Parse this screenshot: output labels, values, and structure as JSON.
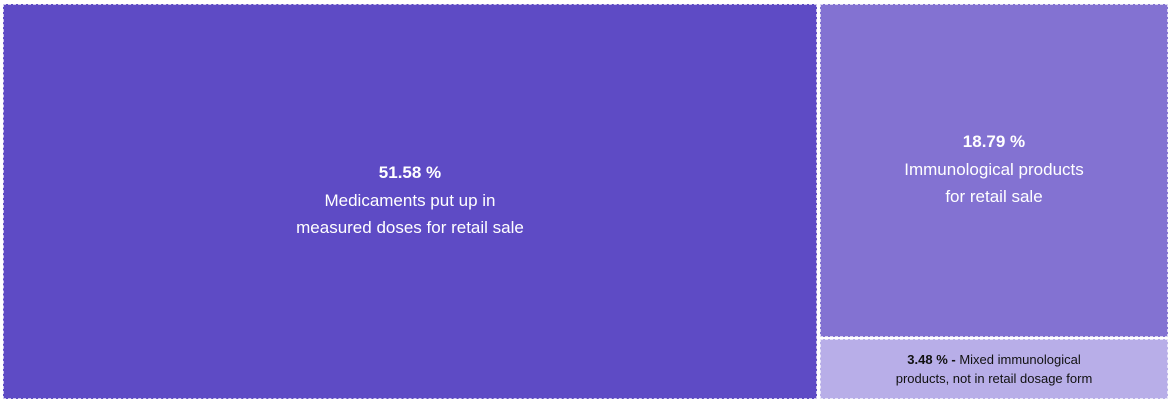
{
  "chart_data": {
    "type": "treemap",
    "items": [
      {
        "percent": "51.58 %",
        "label_lines": [
          "Medicaments put up in",
          "measured doses for retail sale"
        ],
        "value": 51.58,
        "color": "#5e4bc5"
      },
      {
        "percent": "18.79 %",
        "label_lines": [
          "Immunological products",
          "for retail sale"
        ],
        "value": 18.79,
        "color": "#8372d2"
      },
      {
        "percent": "3.48 %",
        "separator": " - ",
        "label_lines": [
          "Mixed immunological",
          "products, not in retail dosage form"
        ],
        "value": 3.48,
        "color": "#b8aee8"
      }
    ]
  }
}
